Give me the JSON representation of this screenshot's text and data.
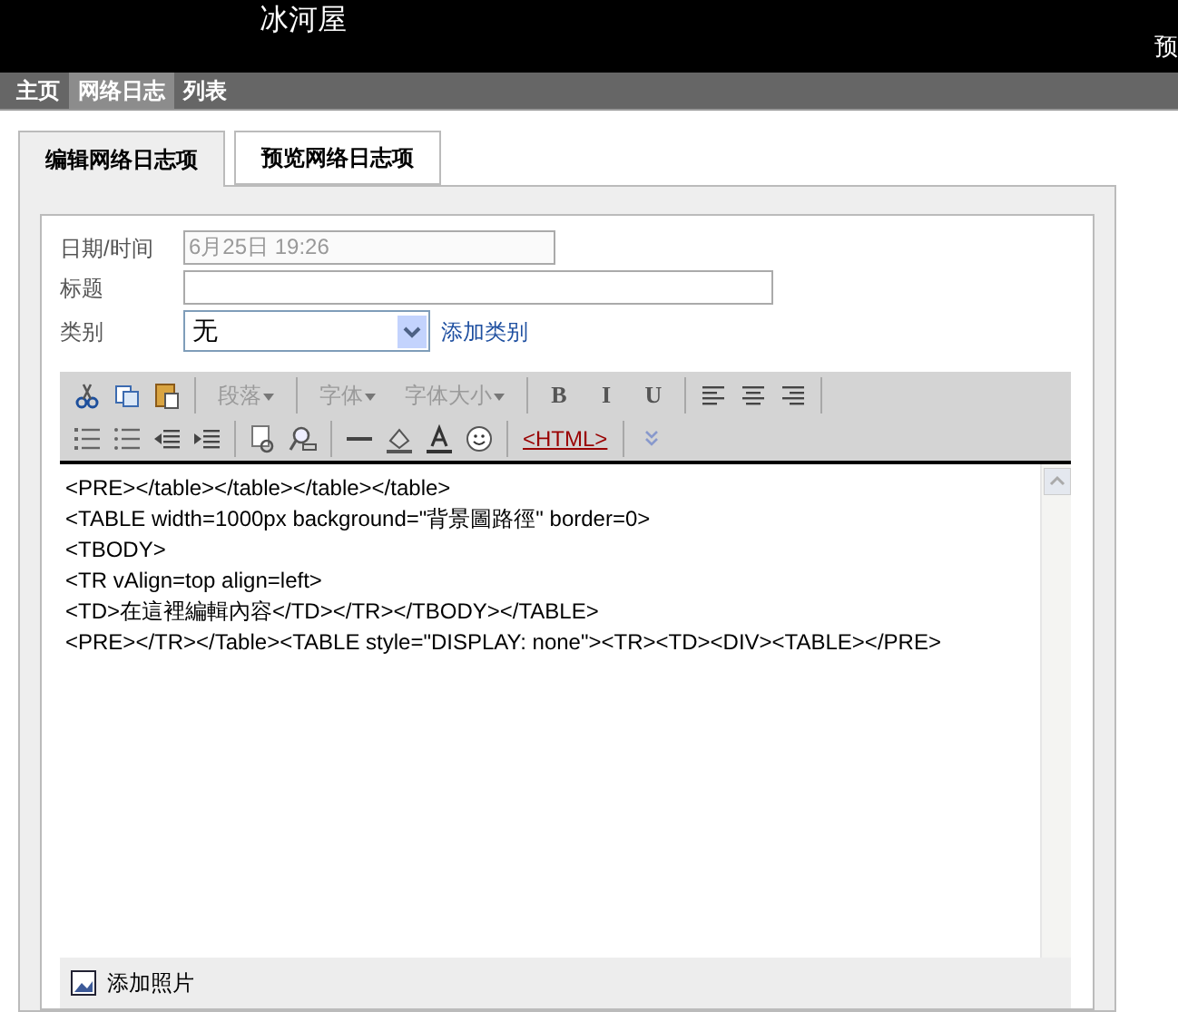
{
  "header": {
    "title": "冰河屋",
    "right_text": "预"
  },
  "nav": [
    {
      "label": "主页",
      "selected": false
    },
    {
      "label": "网络日志",
      "selected": true
    },
    {
      "label": "列表",
      "selected": false
    }
  ],
  "tabs": [
    {
      "label": "编辑网络日志项",
      "selected": true
    },
    {
      "label": "预览网络日志项",
      "selected": false
    }
  ],
  "form": {
    "date_label": "日期/时间",
    "date_value": "6月25日 19:26",
    "title_label": "标题",
    "category_label": "类别",
    "category_value": "无",
    "add_category": "添加类别"
  },
  "toolbar_rows": [
    [
      {
        "kind": "icon"
      },
      {
        "kind": "icon"
      },
      {
        "kind": "icon"
      },
      {
        "kind": "sep"
      },
      {
        "kind": "dropdown",
        "label": "段落"
      },
      {
        "kind": "sep"
      },
      {
        "kind": "dropdown",
        "label": "字体"
      },
      {
        "kind": "dropdown",
        "label": "字体大小"
      },
      {
        "kind": "sep"
      },
      {
        "kind": "format",
        "label": "B"
      },
      {
        "kind": "format",
        "label": "I"
      },
      {
        "kind": "format",
        "label": "U"
      },
      {
        "kind": "sep"
      },
      {
        "kind": "icon"
      },
      {
        "kind": "icon"
      },
      {
        "kind": "icon"
      },
      {
        "kind": "sep"
      }
    ],
    [
      {
        "kind": "icon"
      },
      {
        "kind": "icon"
      },
      {
        "kind": "icon"
      },
      {
        "kind": "icon"
      },
      {
        "kind": "sep"
      },
      {
        "kind": "icon"
      },
      {
        "kind": "icon"
      },
      {
        "kind": "sep"
      },
      {
        "kind": "icon"
      },
      {
        "kind": "icon"
      },
      {
        "kind": "icon"
      },
      {
        "kind": "icon"
      },
      {
        "kind": "sep"
      },
      {
        "kind": "html",
        "label": "<HTML>"
      },
      {
        "kind": "sep"
      },
      {
        "kind": "icon"
      }
    ]
  ],
  "editor_lines": [
    "<PRE></table></table></table></table>",
    "<TABLE width=1000px background=\"背景圖路徑\" border=0>",
    "<TBODY>",
    "<TR vAlign=top align=left>",
    "<TD>在這裡編輯內容</TD></TR></TBODY></TABLE>",
    "<PRE></TR></Table><TABLE style=\"DISPLAY: none\"><TR><TD><DIV><TABLE></PRE>"
  ],
  "add_photo": "添加照片"
}
